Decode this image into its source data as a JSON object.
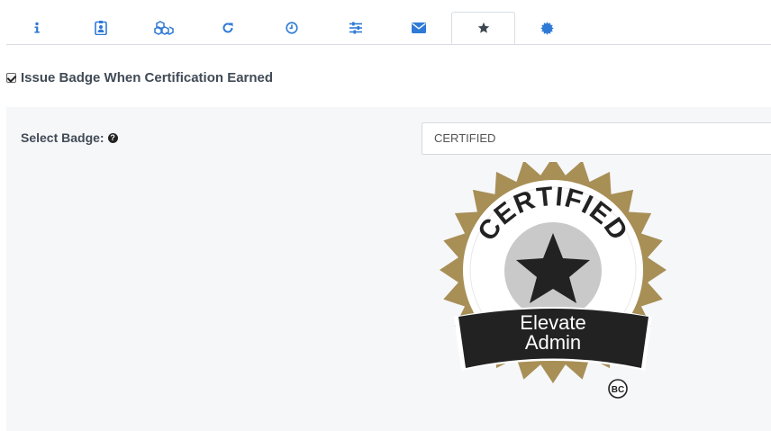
{
  "tabs": [
    {
      "icon": "info-icon"
    },
    {
      "icon": "id-badge-icon"
    },
    {
      "icon": "cubes-icon"
    },
    {
      "icon": "refresh-icon"
    },
    {
      "icon": "clock-icon"
    },
    {
      "icon": "sliders-icon"
    },
    {
      "icon": "envelope-icon"
    },
    {
      "icon": "star-icon",
      "active": true
    },
    {
      "icon": "certificate-icon"
    }
  ],
  "colors": {
    "accent": "#2f7ad6",
    "active_icon": "#3d4650",
    "badge_gold": "#a88f56",
    "badge_black": "#222222"
  },
  "checkbox": {
    "label": "Issue Badge When Certification Earned",
    "checked": true
  },
  "select_badge": {
    "label": "Select Badge:",
    "help_icon": "question-circle-icon",
    "value": "CERTIFIED"
  },
  "badge_image": {
    "top_text": "CERTIFIED",
    "ribbon_line1": "Elevate",
    "ribbon_line2": "Admin",
    "mark": "BC"
  }
}
